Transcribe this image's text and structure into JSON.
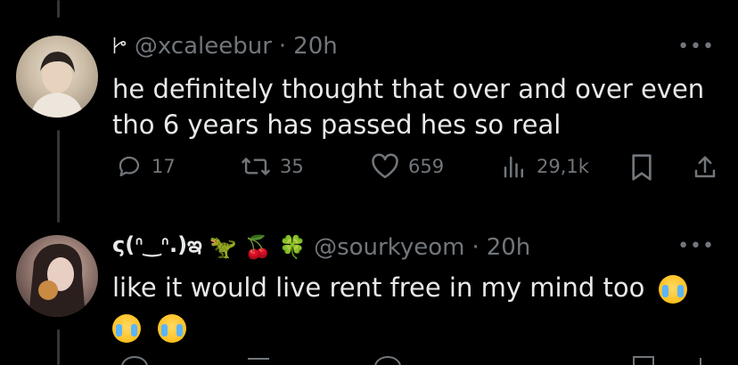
{
  "tweets": [
    {
      "handle": "@xcaleebur",
      "separator": "·",
      "time": "20h",
      "text_line1": "he definitely thought that over and over even",
      "text_line2": "tho 6 years has passed hes so real",
      "actions": {
        "replies": "17",
        "retweets": "35",
        "likes": "659",
        "views": "29,1k"
      }
    },
    {
      "display_name": "ς(ᐢ‿ᐢ.)ఇ",
      "name_emojis": [
        "🦖",
        "🍒",
        "🍀"
      ],
      "handle": "@sourkyeom",
      "separator": "·",
      "time": "20h",
      "text_line1": "like it would live rent free in my mind too",
      "trailing_emoji_count": 3
    }
  ],
  "icons": {
    "more": "more-horizontal-icon",
    "reply": "reply-icon",
    "retweet": "retweet-icon",
    "like": "heart-icon",
    "views": "views-bar-icon",
    "bookmark": "bookmark-icon",
    "share": "share-icon"
  },
  "colors": {
    "background": "#000000",
    "text": "#e7e9ea",
    "muted": "#71767b",
    "line": "#333639"
  }
}
